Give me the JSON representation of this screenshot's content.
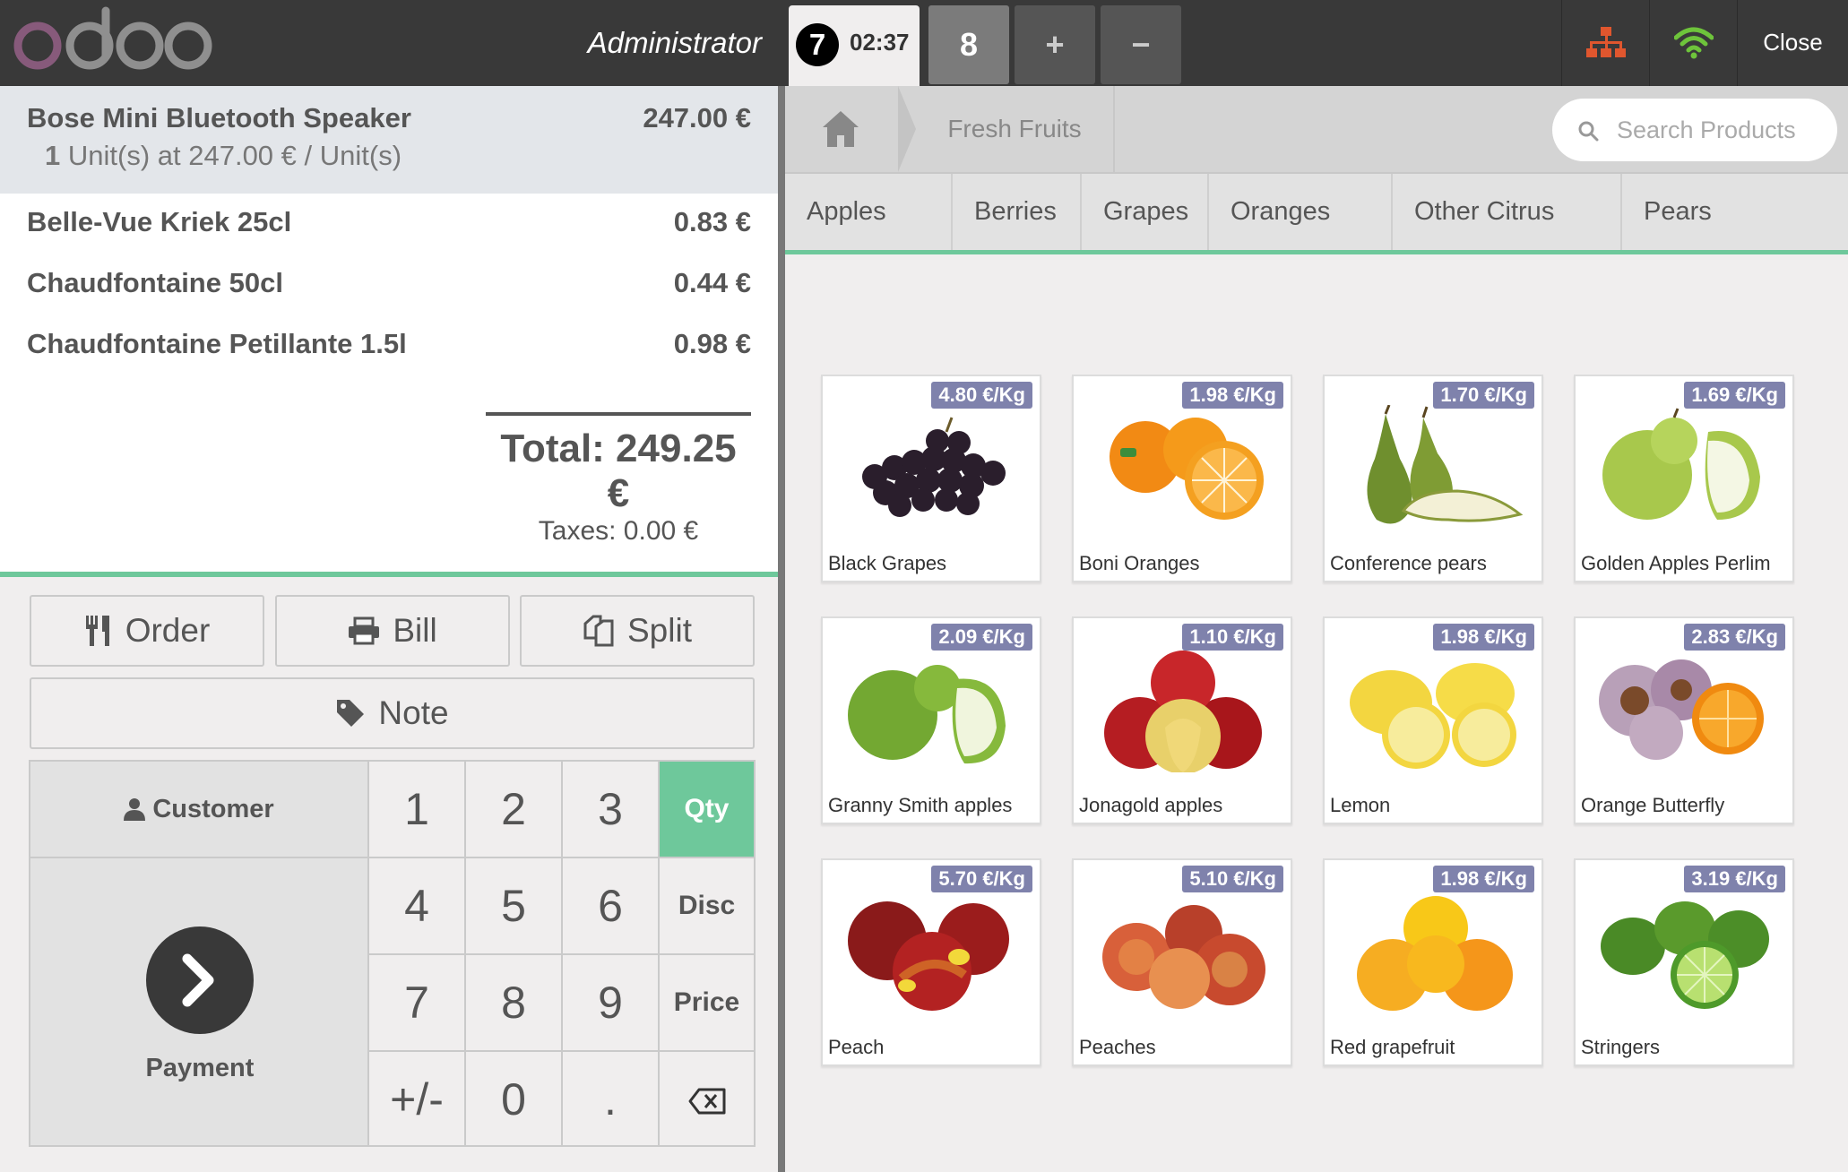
{
  "brand": {
    "logo_text": "odoo",
    "logo_color": "#875a7b"
  },
  "header": {
    "cashier": "Administrator",
    "active_order": {
      "sequence": "7",
      "time": "02:37"
    },
    "other_order": "8",
    "add_order": "+",
    "remove_order": "−",
    "close_label": "Close",
    "icons": [
      "order-number-icon",
      "proxy-device-icon",
      "wifi-icon"
    ]
  },
  "order": {
    "lines": [
      {
        "name": "Bose Mini Bluetooth Speaker",
        "price": "247.00 €",
        "qty": "1",
        "info": "Unit(s) at 247.00 € / Unit(s)",
        "selected": true
      },
      {
        "name": "Belle-Vue Kriek 25cl",
        "price": "0.83 €"
      },
      {
        "name": "Chaudfontaine 50cl",
        "price": "0.44 €"
      },
      {
        "name": "Chaudfontaine Petillante 1.5l",
        "price": "0.98 €"
      }
    ],
    "total": "Total: 249.25 €",
    "taxes": "Taxes: 0.00 €"
  },
  "actions": {
    "order": "Order",
    "bill": "Bill",
    "split": "Split",
    "note": "Note"
  },
  "numpad": {
    "customer": "Customer",
    "payment": "Payment",
    "keys": [
      "1",
      "2",
      "3",
      "4",
      "5",
      "6",
      "7",
      "8",
      "9",
      "+/-",
      "0",
      "."
    ],
    "modes": [
      "Qty",
      "Disc",
      "Price"
    ],
    "active_mode": "Qty"
  },
  "breadcrumb": {
    "category": "Fresh Fruits"
  },
  "search": {
    "placeholder": "Search Products"
  },
  "categories": [
    "Apples",
    "Berries",
    "Grapes",
    "Oranges",
    "Other Citrus",
    "Pears"
  ],
  "products": [
    {
      "name": "Black Grapes",
      "price": "4.80 €/Kg",
      "image": "black-grapes"
    },
    {
      "name": "Boni Oranges",
      "price": "1.98 €/Kg",
      "image": "oranges"
    },
    {
      "name": "Conference pears",
      "price": "1.70 €/Kg",
      "image": "pears"
    },
    {
      "name": "Golden Apples Perlim",
      "price": "1.69 €/Kg",
      "image": "green-apples"
    },
    {
      "name": "Granny Smith apples",
      "price": "2.09 €/Kg",
      "image": "green-apples"
    },
    {
      "name": "Jonagold apples",
      "price": "1.10 €/Kg",
      "image": "red-apples"
    },
    {
      "name": "Lemon",
      "price": "1.98 €/Kg",
      "image": "lemons"
    },
    {
      "name": "Orange Butterfly",
      "price": "2.83 €/Kg",
      "image": "orange-butterfly"
    },
    {
      "name": "Peach",
      "price": "5.70 €/Kg",
      "image": "nectarines"
    },
    {
      "name": "Peaches",
      "price": "5.10 €/Kg",
      "image": "peaches"
    },
    {
      "name": "Red grapefruit",
      "price": "1.98 €/Kg",
      "image": "grapefruit"
    },
    {
      "name": "Stringers",
      "price": "3.19 €/Kg",
      "image": "limes"
    }
  ],
  "colors": {
    "accent": "#6ec89b",
    "price_tag": "#7f82ac",
    "topbar": "#393939",
    "alert_icon": "#e0562e",
    "wifi": "#6ec43b"
  }
}
